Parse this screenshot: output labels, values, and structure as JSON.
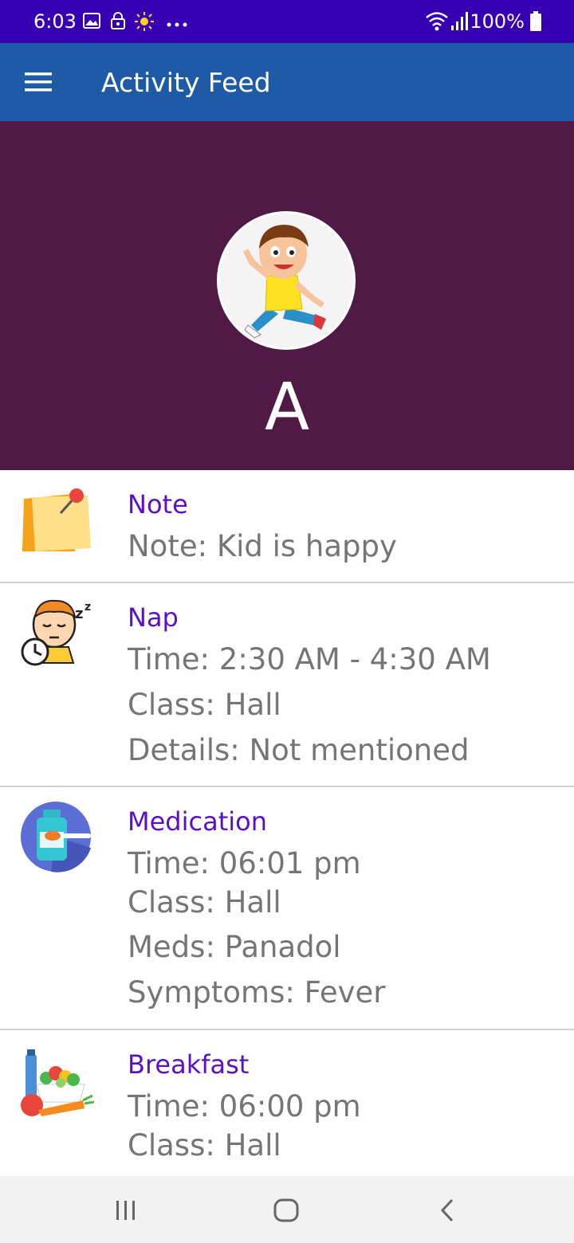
{
  "status_bar": {
    "time": "6:03",
    "battery": "100%",
    "icons": [
      "gallery-icon",
      "lock-icon",
      "brightness-icon",
      "more-dots-icon",
      "wifi-icon",
      "signal-icon",
      "battery-icon"
    ]
  },
  "app_bar": {
    "title": "Activity Feed",
    "menu_icon": "hamburger-menu-icon"
  },
  "profile": {
    "initial": "A",
    "avatar": "boy-cartoon-avatar"
  },
  "colors": {
    "status_bar": "#3700b3",
    "app_bar": "#1f5aa6",
    "profile_bg": "#511946",
    "card_title": "#5a10c8",
    "card_text": "#757575"
  },
  "feed": [
    {
      "icon": "sticky-note-icon",
      "title": "Note",
      "lines": [
        "Note: Kid is happy"
      ]
    },
    {
      "icon": "nap-icon",
      "title": "Nap",
      "lines": [
        "Time: 2:30 AM - 4:30 AM",
        "Class: Hall",
        "Details: Not mentioned"
      ]
    },
    {
      "icon": "medication-icon",
      "title": "Medication",
      "lines": [
        "Time: 06:01 pm",
        "Class: Hall",
        "Meds: Panadol",
        "Symptoms: Fever"
      ]
    },
    {
      "icon": "breakfast-icon",
      "title": "Breakfast",
      "lines": [
        "Time: 06:00 pm",
        "Class: Hall"
      ]
    }
  ],
  "nav_bar": {
    "icons": [
      "recent-apps-icon",
      "home-icon",
      "back-icon"
    ]
  }
}
